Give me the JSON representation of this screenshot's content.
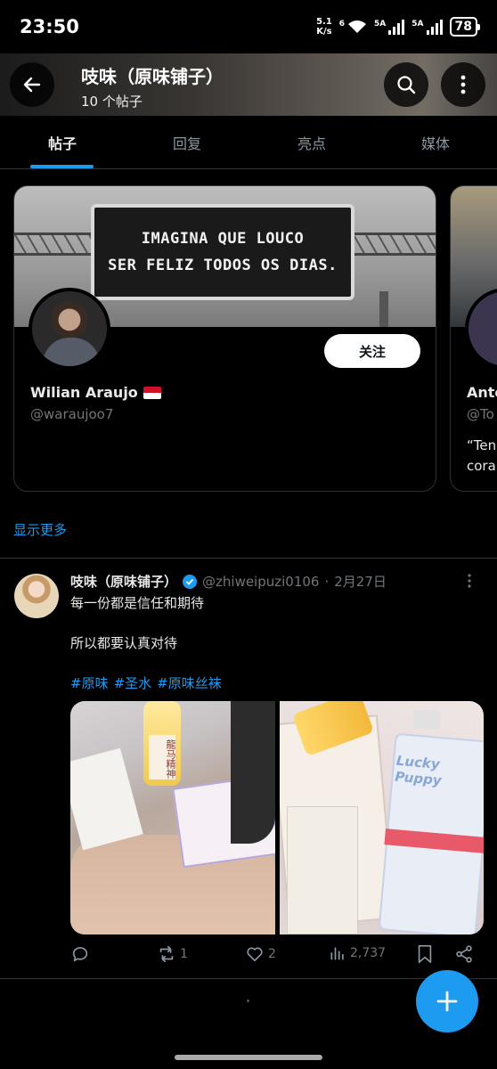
{
  "status_bar": {
    "time": "23:50",
    "net_speed_value": "5.1",
    "net_speed_unit": "K/s",
    "wifi_tag": "6",
    "sim1_tag": "5A",
    "sim2_tag": "5A",
    "battery": "78"
  },
  "header": {
    "title": "吱味（原味铺子）",
    "subtitle": "10 个帖子"
  },
  "tabs": [
    {
      "label": "帖子",
      "active": true
    },
    {
      "label": "回复",
      "active": false
    },
    {
      "label": "亮点",
      "active": false
    },
    {
      "label": "媒体",
      "active": false
    }
  ],
  "suggested": {
    "cards": [
      {
        "banner_lines": [
          "IMAGINA QUE LOUCO",
          "SER FELIZ TODOS OS DIAS."
        ],
        "name": "Wilian Araujo",
        "handle": "@waraujoo7",
        "follow_label": "关注"
      },
      {
        "name": "Antô",
        "handle": "@To",
        "bio_lines": [
          "“Ten",
          "cora"
        ]
      }
    ],
    "show_more": "显示更多"
  },
  "post": {
    "name": "吱味（原味铺子）",
    "handle": "@zhiweipuzi0106",
    "separator": "·",
    "date": "2月27日",
    "lines": [
      "每一份都是信任和期待",
      "所以都要认真对待"
    ],
    "hashtags": [
      "#原味",
      "#圣水",
      "#原味丝袜"
    ],
    "bottle_label": "龍马精神",
    "packet_label": "Lucky Puppy",
    "actions": {
      "replies": "",
      "reposts": "1",
      "likes": "2",
      "views": "2,737"
    }
  },
  "colors": {
    "accent": "#1d9bf0",
    "background": "#000000",
    "text": "#e7e9ea",
    "muted": "#71767b"
  }
}
